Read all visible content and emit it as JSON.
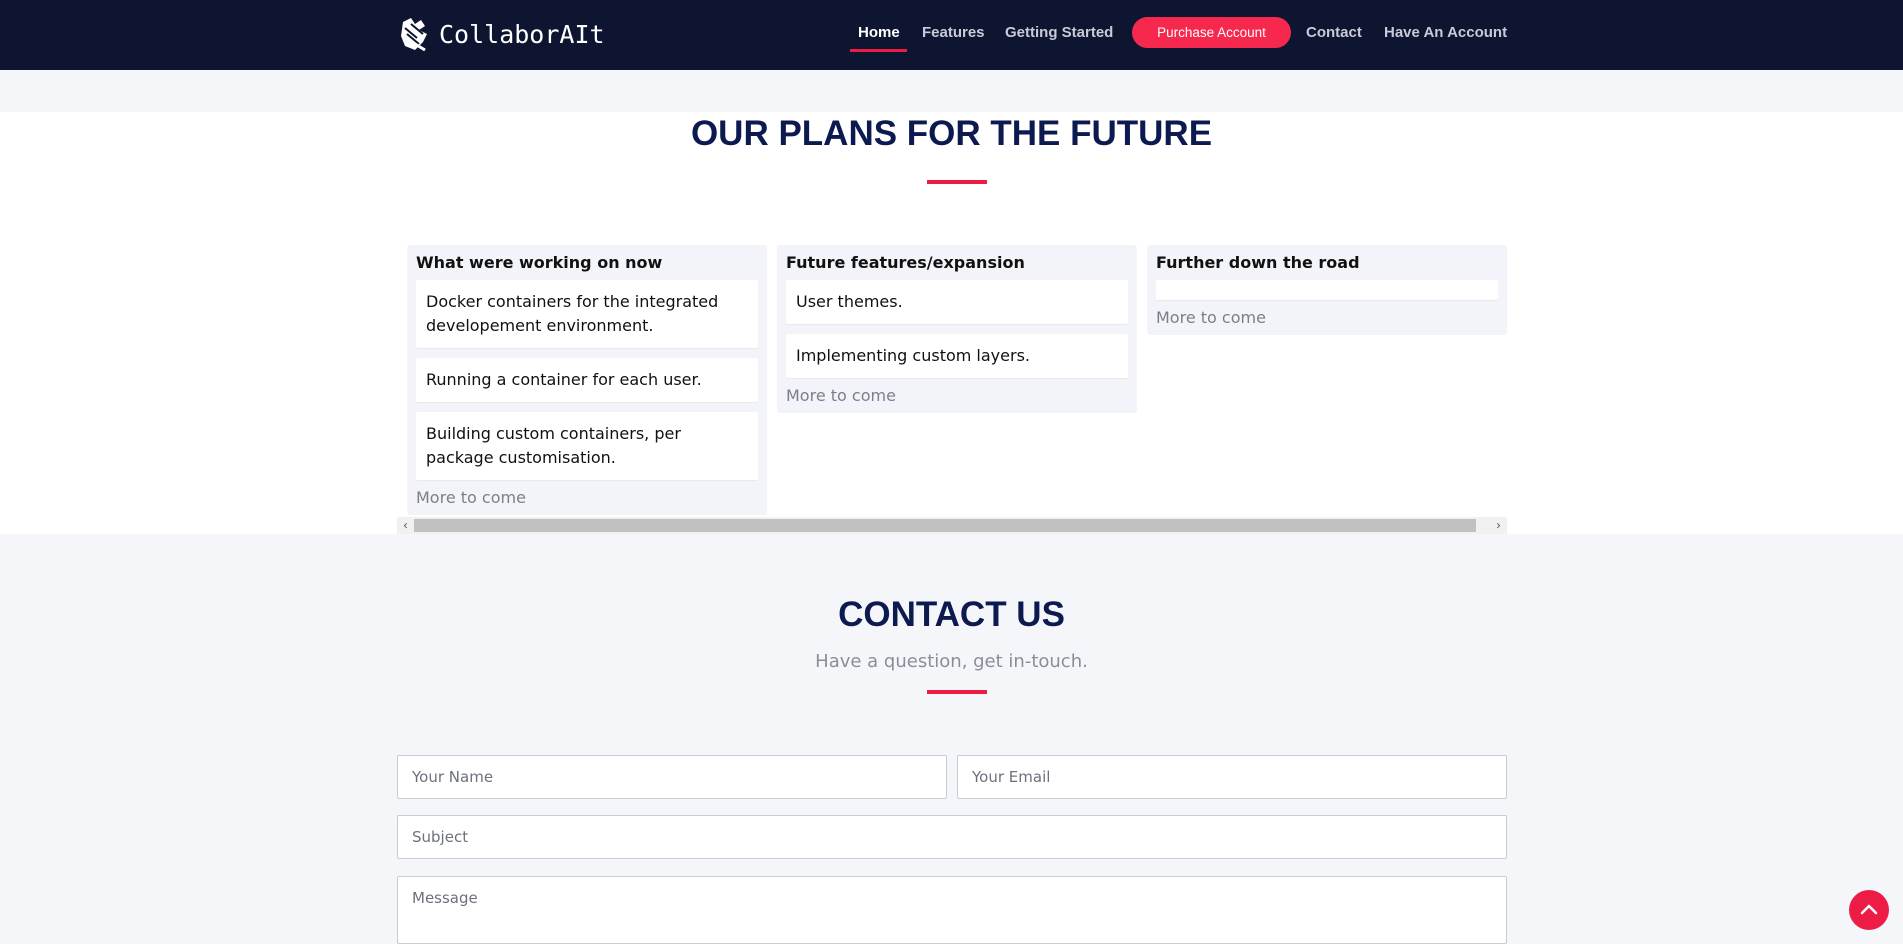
{
  "header": {
    "logo_text": "CollaborAIt",
    "nav": {
      "home": "Home",
      "features": "Features",
      "getting_started": "Getting Started",
      "purchase": "Purchase Account",
      "contact": "Contact",
      "have_account": "Have An Account"
    }
  },
  "plans": {
    "title": "OUR PLANS FOR THE FUTURE",
    "columns": [
      {
        "title": "What were working on now",
        "cards": [
          "Docker containers for the integrated developement environment.",
          "Running a container for each user.",
          "Building custom containers, per package customisation."
        ],
        "more": "More to come"
      },
      {
        "title": "Future features/expansion",
        "cards": [
          "User themes.",
          "Implementing custom layers."
        ],
        "more": "More to come"
      },
      {
        "title": "Further down the road",
        "cards": [
          ""
        ],
        "more": "More to come"
      }
    ]
  },
  "contact": {
    "title": "CONTACT US",
    "subtitle": "Have a question, get in-touch.",
    "name_placeholder": "Your Name",
    "email_placeholder": "Your Email",
    "subject_placeholder": "Subject",
    "message_placeholder": "Message"
  },
  "colors": {
    "header_bg": "#0d1531",
    "accent": "#ed1c47",
    "title": "#0d1a4f"
  },
  "icons": {
    "logo": "hand-logo-icon",
    "scroll_left": "chevron-left-icon",
    "scroll_right": "chevron-right-icon",
    "back_to_top": "chevron-up-icon"
  }
}
